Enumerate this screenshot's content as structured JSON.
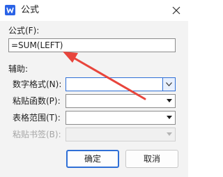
{
  "window": {
    "title": "公式",
    "close_icon": "close-icon",
    "app_icon": "wps-writer-icon"
  },
  "formula": {
    "label": "公式(F):",
    "value": "=SUM(LEFT)"
  },
  "assist": {
    "label": "辅助:"
  },
  "fields": {
    "number_format": {
      "label": "数字格式(N):",
      "value": ""
    },
    "paste_function": {
      "label": "粘贴函数(P):",
      "value": ""
    },
    "table_range": {
      "label": "表格范围(T):",
      "value": ""
    },
    "paste_bookmark": {
      "label": "粘贴书签(B):",
      "value": ""
    }
  },
  "buttons": {
    "ok": "确定",
    "cancel": "取消"
  },
  "colors": {
    "accent": "#2f6fd6",
    "annotation_arrow": "#e8453c",
    "app_icon": "#2b63e6"
  }
}
